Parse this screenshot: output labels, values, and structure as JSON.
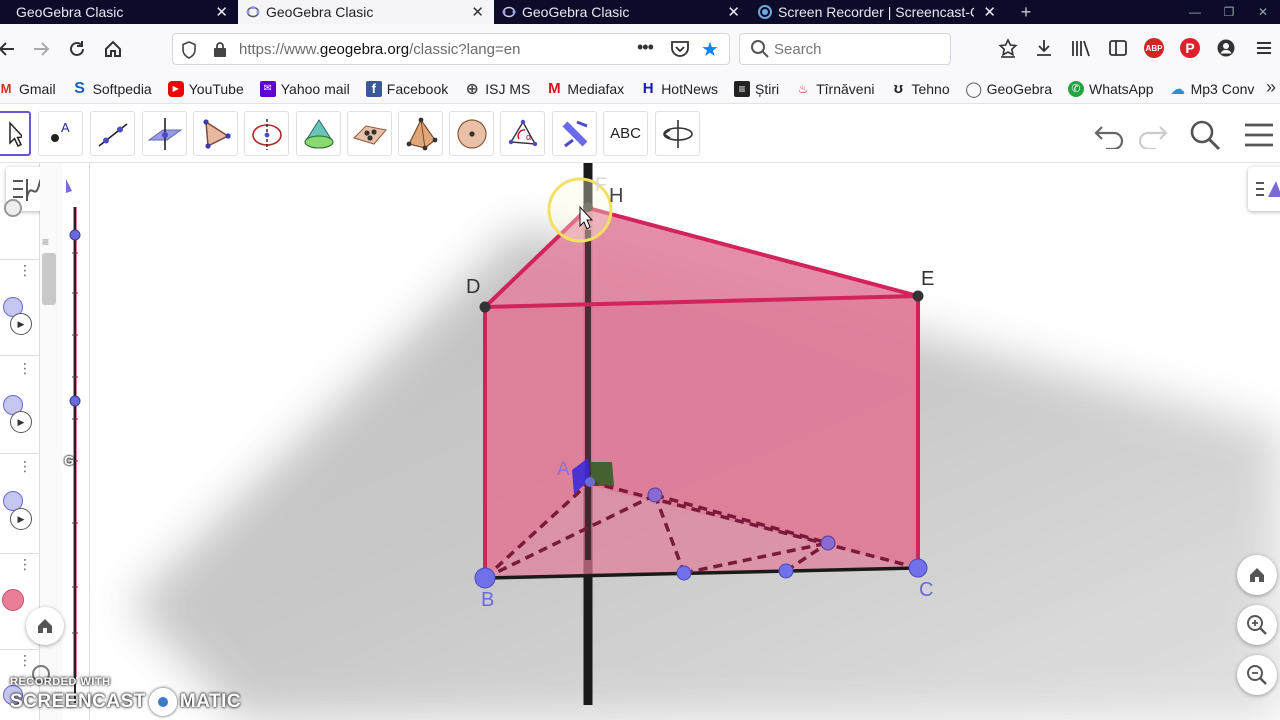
{
  "browser": {
    "tabs": [
      {
        "title": "GeoGebra Clasic",
        "active": false
      },
      {
        "title": "GeoGebra Clasic",
        "active": true
      },
      {
        "title": "GeoGebra Clasic",
        "active": false
      },
      {
        "title": "Screen Recorder | Screencast-O",
        "active": false
      }
    ],
    "url_prefix": "https://www.",
    "url_host": "geogebra.org",
    "url_path": "/classic?lang=en",
    "search_placeholder": "Search",
    "bookmarks": [
      {
        "label": "Gmail",
        "icon": "M"
      },
      {
        "label": "Softpedia",
        "icon": "S"
      },
      {
        "label": "YouTube",
        "icon": "▶"
      },
      {
        "label": "Yahoo  mail",
        "icon": "✉"
      },
      {
        "label": "Facebook",
        "icon": "f"
      },
      {
        "label": "ISJ MS",
        "icon": "⊕"
      },
      {
        "label": "Mediafax",
        "icon": "M"
      },
      {
        "label": "HotNews",
        "icon": "H"
      },
      {
        "label": "Știri",
        "icon": "≡"
      },
      {
        "label": "Tîrnăveni",
        "icon": "♨"
      },
      {
        "label": "Tehno",
        "icon": "ʊ"
      },
      {
        "label": "GeoGebra",
        "icon": "◯"
      },
      {
        "label": "WhatsApp",
        "icon": "✆"
      },
      {
        "label": "Mp3 Conv",
        "icon": "☁"
      }
    ],
    "overflow": "»"
  },
  "geogebra": {
    "tool_text_label": "ABC",
    "points": {
      "F": "F",
      "H": "H",
      "D": "D",
      "E": "E",
      "A": "A",
      "B": "B",
      "C": "C"
    },
    "graphics2_label": "G"
  },
  "colors": {
    "prism_fill": "#e07a97",
    "prism_edge": "#d0245a",
    "accent": "#6557d2",
    "tab_bar": "#0c0c2a"
  },
  "watermark": {
    "line1": "RECORDED WITH",
    "line2a": "SCREENCAST",
    "line2b": "MATIC"
  }
}
